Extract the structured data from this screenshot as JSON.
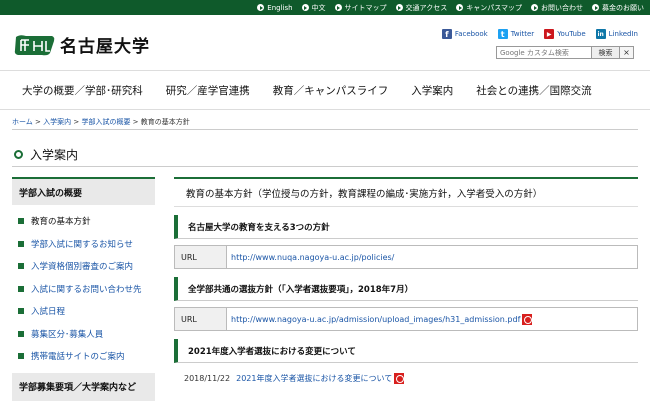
{
  "topbar": {
    "links": [
      "English",
      "中文",
      "サイトマップ",
      "交通アクセス",
      "キャンパスマップ",
      "お問い合わせ",
      "募金のお願い"
    ]
  },
  "header": {
    "logo_text": "名古屋大学",
    "social": [
      {
        "name": "Facebook",
        "color": "#3b5998",
        "icon": "facebook-icon",
        "glyph": "f"
      },
      {
        "name": "Twitter",
        "color": "#1da1f2",
        "icon": "twitter-icon",
        "glyph": "t"
      },
      {
        "name": "YouTube",
        "color": "#cc181e",
        "icon": "youtube-icon",
        "glyph": "▶"
      },
      {
        "name": "LinkedIn",
        "color": "#0e76a8",
        "icon": "linkedin-icon",
        "glyph": "in"
      }
    ],
    "search": {
      "placeholder": "Google カスタム検索",
      "button": "検索",
      "clear": "×"
    }
  },
  "gnav": [
    "大学の概要／学部･研究科",
    "研究／産学官連携",
    "教育／キャンパスライフ",
    "入学案内",
    "社会との連携／国際交流"
  ],
  "breadcrumb": {
    "items": [
      "ホーム",
      "入学案内",
      "学部入試の概要"
    ],
    "sep": " > ",
    "current": "教育の基本方針"
  },
  "page_title": "入学案内",
  "sidebar": {
    "heading": "学部入試の概要",
    "items": [
      {
        "label": "教育の基本方針",
        "current": true
      },
      {
        "label": "学部入試に関するお知らせ",
        "current": false
      },
      {
        "label": "入学資格個別審査のご案内",
        "current": false
      },
      {
        "label": "入試に関するお問い合わせ先",
        "current": false
      },
      {
        "label": "入試日程",
        "current": false
      },
      {
        "label": "募集区分･募集人員",
        "current": false
      },
      {
        "label": "携帯電話サイトのご案内",
        "current": false
      }
    ],
    "heading2": "学部募集要項／大学案内など"
  },
  "main": {
    "heading": "教育の基本方針（学位授与の方針，教育課程の編成･実施方針，入学者受入の方針）",
    "section1": {
      "title": "名古屋大学の教育を支える3つの方針",
      "key": "URL",
      "url": "http://www.nuqa.nagoya-u.ac.jp/policies/"
    },
    "section2": {
      "title": "全学部共通の選抜方針（「入学者選抜要項」，2018年7月）",
      "key": "URL",
      "url": "http://www.nagoya-u.ac.jp/admission/upload_images/h31_admission.pdf"
    },
    "section3": {
      "title": "2021年度入学者選抜における変更について",
      "date": "2018/11/22",
      "link": "2021年度入学者選抜における変更について"
    }
  },
  "colors": {
    "brand_green": "#1b6e37",
    "topbar_green": "#0f5a2b",
    "link_blue": "#1a55a6",
    "pdf_red": "#d8201e"
  }
}
